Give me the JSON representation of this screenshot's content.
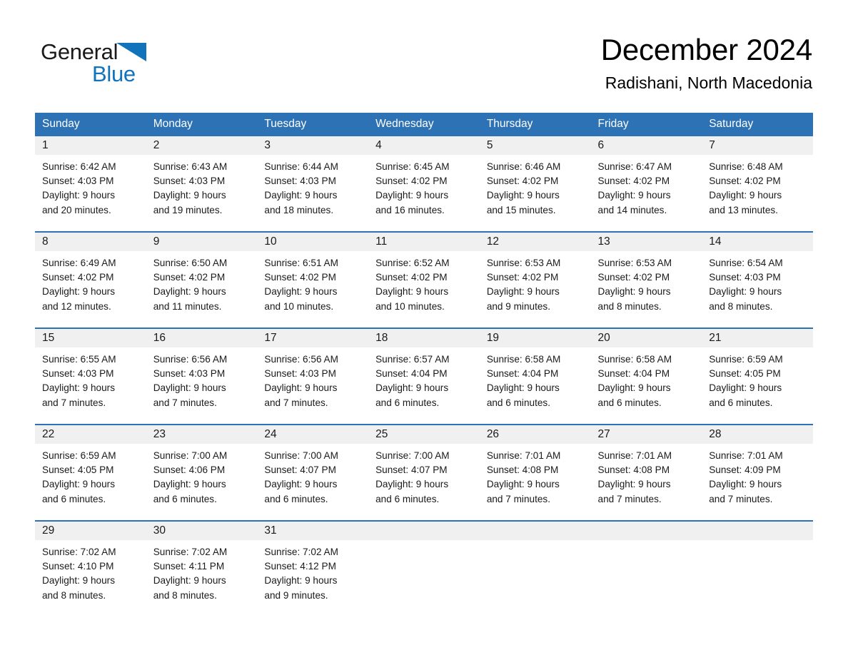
{
  "brand": {
    "name_part1": "General",
    "name_part2": "Blue",
    "triangle_color": "#1273bd",
    "text_color": "#1a1a1a"
  },
  "header": {
    "title": "December 2024",
    "location": "Radishani, North Macedonia"
  },
  "theme": {
    "header_blue": "#2d72b4",
    "daynum_gray": "#f0f0f0",
    "divider_blue": "#2d72b4",
    "cell_white": "#ffffff",
    "text_black": "#1a1a1a"
  },
  "weekdays": [
    "Sunday",
    "Monday",
    "Tuesday",
    "Wednesday",
    "Thursday",
    "Friday",
    "Saturday"
  ],
  "weeks": [
    [
      {
        "day": "1",
        "sunrise": "Sunrise: 6:42 AM",
        "sunset": "Sunset: 4:03 PM",
        "daylight_line1": "Daylight: 9 hours",
        "daylight_line2": "and 20 minutes."
      },
      {
        "day": "2",
        "sunrise": "Sunrise: 6:43 AM",
        "sunset": "Sunset: 4:03 PM",
        "daylight_line1": "Daylight: 9 hours",
        "daylight_line2": "and 19 minutes."
      },
      {
        "day": "3",
        "sunrise": "Sunrise: 6:44 AM",
        "sunset": "Sunset: 4:03 PM",
        "daylight_line1": "Daylight: 9 hours",
        "daylight_line2": "and 18 minutes."
      },
      {
        "day": "4",
        "sunrise": "Sunrise: 6:45 AM",
        "sunset": "Sunset: 4:02 PM",
        "daylight_line1": "Daylight: 9 hours",
        "daylight_line2": "and 16 minutes."
      },
      {
        "day": "5",
        "sunrise": "Sunrise: 6:46 AM",
        "sunset": "Sunset: 4:02 PM",
        "daylight_line1": "Daylight: 9 hours",
        "daylight_line2": "and 15 minutes."
      },
      {
        "day": "6",
        "sunrise": "Sunrise: 6:47 AM",
        "sunset": "Sunset: 4:02 PM",
        "daylight_line1": "Daylight: 9 hours",
        "daylight_line2": "and 14 minutes."
      },
      {
        "day": "7",
        "sunrise": "Sunrise: 6:48 AM",
        "sunset": "Sunset: 4:02 PM",
        "daylight_line1": "Daylight: 9 hours",
        "daylight_line2": "and 13 minutes."
      }
    ],
    [
      {
        "day": "8",
        "sunrise": "Sunrise: 6:49 AM",
        "sunset": "Sunset: 4:02 PM",
        "daylight_line1": "Daylight: 9 hours",
        "daylight_line2": "and 12 minutes."
      },
      {
        "day": "9",
        "sunrise": "Sunrise: 6:50 AM",
        "sunset": "Sunset: 4:02 PM",
        "daylight_line1": "Daylight: 9 hours",
        "daylight_line2": "and 11 minutes."
      },
      {
        "day": "10",
        "sunrise": "Sunrise: 6:51 AM",
        "sunset": "Sunset: 4:02 PM",
        "daylight_line1": "Daylight: 9 hours",
        "daylight_line2": "and 10 minutes."
      },
      {
        "day": "11",
        "sunrise": "Sunrise: 6:52 AM",
        "sunset": "Sunset: 4:02 PM",
        "daylight_line1": "Daylight: 9 hours",
        "daylight_line2": "and 10 minutes."
      },
      {
        "day": "12",
        "sunrise": "Sunrise: 6:53 AM",
        "sunset": "Sunset: 4:02 PM",
        "daylight_line1": "Daylight: 9 hours",
        "daylight_line2": "and 9 minutes."
      },
      {
        "day": "13",
        "sunrise": "Sunrise: 6:53 AM",
        "sunset": "Sunset: 4:02 PM",
        "daylight_line1": "Daylight: 9 hours",
        "daylight_line2": "and 8 minutes."
      },
      {
        "day": "14",
        "sunrise": "Sunrise: 6:54 AM",
        "sunset": "Sunset: 4:03 PM",
        "daylight_line1": "Daylight: 9 hours",
        "daylight_line2": "and 8 minutes."
      }
    ],
    [
      {
        "day": "15",
        "sunrise": "Sunrise: 6:55 AM",
        "sunset": "Sunset: 4:03 PM",
        "daylight_line1": "Daylight: 9 hours",
        "daylight_line2": "and 7 minutes."
      },
      {
        "day": "16",
        "sunrise": "Sunrise: 6:56 AM",
        "sunset": "Sunset: 4:03 PM",
        "daylight_line1": "Daylight: 9 hours",
        "daylight_line2": "and 7 minutes."
      },
      {
        "day": "17",
        "sunrise": "Sunrise: 6:56 AM",
        "sunset": "Sunset: 4:03 PM",
        "daylight_line1": "Daylight: 9 hours",
        "daylight_line2": "and 7 minutes."
      },
      {
        "day": "18",
        "sunrise": "Sunrise: 6:57 AM",
        "sunset": "Sunset: 4:04 PM",
        "daylight_line1": "Daylight: 9 hours",
        "daylight_line2": "and 6 minutes."
      },
      {
        "day": "19",
        "sunrise": "Sunrise: 6:58 AM",
        "sunset": "Sunset: 4:04 PM",
        "daylight_line1": "Daylight: 9 hours",
        "daylight_line2": "and 6 minutes."
      },
      {
        "day": "20",
        "sunrise": "Sunrise: 6:58 AM",
        "sunset": "Sunset: 4:04 PM",
        "daylight_line1": "Daylight: 9 hours",
        "daylight_line2": "and 6 minutes."
      },
      {
        "day": "21",
        "sunrise": "Sunrise: 6:59 AM",
        "sunset": "Sunset: 4:05 PM",
        "daylight_line1": "Daylight: 9 hours",
        "daylight_line2": "and 6 minutes."
      }
    ],
    [
      {
        "day": "22",
        "sunrise": "Sunrise: 6:59 AM",
        "sunset": "Sunset: 4:05 PM",
        "daylight_line1": "Daylight: 9 hours",
        "daylight_line2": "and 6 minutes."
      },
      {
        "day": "23",
        "sunrise": "Sunrise: 7:00 AM",
        "sunset": "Sunset: 4:06 PM",
        "daylight_line1": "Daylight: 9 hours",
        "daylight_line2": "and 6 minutes."
      },
      {
        "day": "24",
        "sunrise": "Sunrise: 7:00 AM",
        "sunset": "Sunset: 4:07 PM",
        "daylight_line1": "Daylight: 9 hours",
        "daylight_line2": "and 6 minutes."
      },
      {
        "day": "25",
        "sunrise": "Sunrise: 7:00 AM",
        "sunset": "Sunset: 4:07 PM",
        "daylight_line1": "Daylight: 9 hours",
        "daylight_line2": "and 6 minutes."
      },
      {
        "day": "26",
        "sunrise": "Sunrise: 7:01 AM",
        "sunset": "Sunset: 4:08 PM",
        "daylight_line1": "Daylight: 9 hours",
        "daylight_line2": "and 7 minutes."
      },
      {
        "day": "27",
        "sunrise": "Sunrise: 7:01 AM",
        "sunset": "Sunset: 4:08 PM",
        "daylight_line1": "Daylight: 9 hours",
        "daylight_line2": "and 7 minutes."
      },
      {
        "day": "28",
        "sunrise": "Sunrise: 7:01 AM",
        "sunset": "Sunset: 4:09 PM",
        "daylight_line1": "Daylight: 9 hours",
        "daylight_line2": "and 7 minutes."
      }
    ],
    [
      {
        "day": "29",
        "sunrise": "Sunrise: 7:02 AM",
        "sunset": "Sunset: 4:10 PM",
        "daylight_line1": "Daylight: 9 hours",
        "daylight_line2": "and 8 minutes."
      },
      {
        "day": "30",
        "sunrise": "Sunrise: 7:02 AM",
        "sunset": "Sunset: 4:11 PM",
        "daylight_line1": "Daylight: 9 hours",
        "daylight_line2": "and 8 minutes."
      },
      {
        "day": "31",
        "sunrise": "Sunrise: 7:02 AM",
        "sunset": "Sunset: 4:12 PM",
        "daylight_line1": "Daylight: 9 hours",
        "daylight_line2": "and 9 minutes."
      },
      {
        "day": "",
        "sunrise": "",
        "sunset": "",
        "daylight_line1": "",
        "daylight_line2": ""
      },
      {
        "day": "",
        "sunrise": "",
        "sunset": "",
        "daylight_line1": "",
        "daylight_line2": ""
      },
      {
        "day": "",
        "sunrise": "",
        "sunset": "",
        "daylight_line1": "",
        "daylight_line2": ""
      },
      {
        "day": "",
        "sunrise": "",
        "sunset": "",
        "daylight_line1": "",
        "daylight_line2": ""
      }
    ]
  ]
}
